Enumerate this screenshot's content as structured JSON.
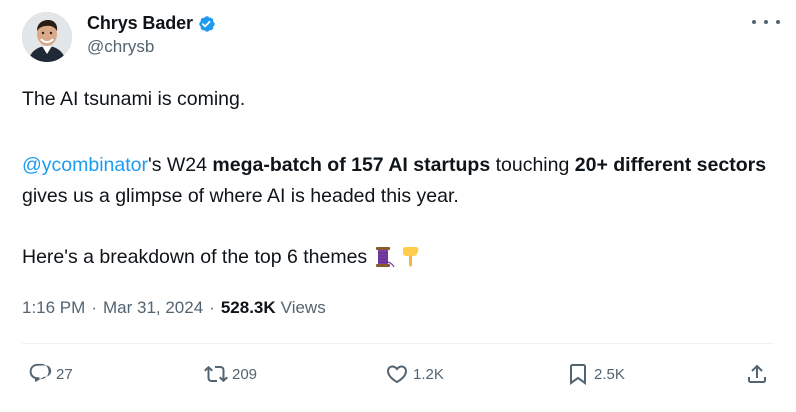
{
  "author": {
    "display_name": "Chrys Bader",
    "handle": "@chrysb",
    "verified": true,
    "verified_color": "#1d9bf0"
  },
  "tweet": {
    "line1": "The AI tsunami is coming.",
    "p2": {
      "mention": "@ycombinator",
      "t1": "'s W24 ",
      "b1": "mega-batch of 157 AI startups",
      "t2": " touching ",
      "b2": "20+ different sectors",
      "t3": " gives us a glimpse of where AI is headed this year."
    },
    "line3": "Here's a breakdown of the top 6 themes",
    "emojis": [
      "thread-icon",
      "pointing-down-icon"
    ]
  },
  "meta": {
    "time": "1:16 PM",
    "date": "Mar 31, 2024",
    "separator": "·",
    "views_count": "528.3K",
    "views_label": "Views"
  },
  "actions": {
    "replies": "27",
    "reposts": "209",
    "likes": "1.2K",
    "bookmarks": "2.5K"
  },
  "colors": {
    "text": "#0f1419",
    "secondary": "#536471",
    "link": "#1d9bf0",
    "divider": "#eff3f4"
  }
}
